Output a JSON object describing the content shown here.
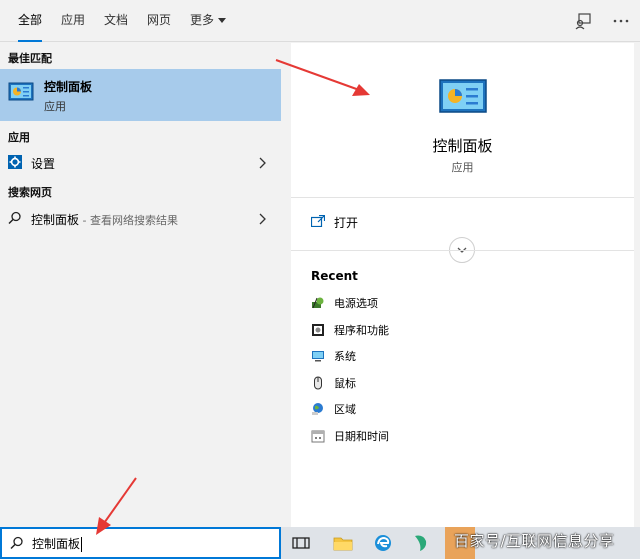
{
  "tabs": [
    {
      "label": "全部",
      "active": true
    },
    {
      "label": "应用",
      "active": false
    },
    {
      "label": "文档",
      "active": false
    },
    {
      "label": "网页",
      "active": false
    },
    {
      "label": "更多",
      "active": false
    }
  ],
  "left": {
    "best_match_header": "最佳匹配",
    "best_match": {
      "title": "控制面板",
      "subtitle": "应用",
      "icon": "control-panel-icon"
    },
    "apps_header": "应用",
    "apps": [
      {
        "label": "设置",
        "icon": "gear-icon"
      }
    ],
    "web_header": "搜索网页",
    "web": [
      {
        "label": "控制面板",
        "hint": " - 查看网络搜索结果",
        "icon": "search-icon"
      }
    ]
  },
  "preview": {
    "title": "控制面板",
    "subtitle": "应用",
    "open_label": "打开",
    "recent_header": "Recent",
    "recent": [
      {
        "label": "电源选项",
        "icon": "power-options-icon"
      },
      {
        "label": "程序和功能",
        "icon": "programs-icon"
      },
      {
        "label": "系统",
        "icon": "system-icon"
      },
      {
        "label": "鼠标",
        "icon": "mouse-icon"
      },
      {
        "label": "区域",
        "icon": "region-icon"
      },
      {
        "label": "日期和时间",
        "icon": "date-time-icon"
      }
    ]
  },
  "search": {
    "value": "控制面板"
  },
  "watermark": "百家号/互联网信息分享",
  "colors": {
    "accent": "#0078d7",
    "selected": "#a7cbeb",
    "arrow": "#e53935"
  }
}
